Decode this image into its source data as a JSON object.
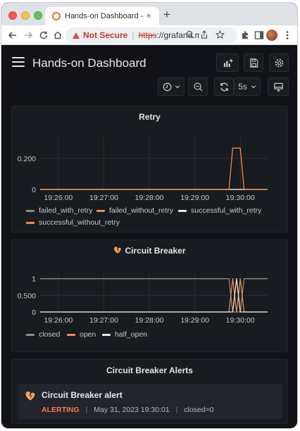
{
  "browser": {
    "tab_title": "Hands-on Dashboard - Grafana",
    "new_tab": "+",
    "tab_close": "×",
    "security_label": "Not Secure",
    "url_scheme": "https",
    "url_rest": "://grafana.mi..."
  },
  "dashboard": {
    "title": "Hands-on Dashboard",
    "refresh_interval": "5s"
  },
  "panels": {
    "retry": {
      "title": "Retry"
    },
    "circuit": {
      "title": "Circuit Breaker"
    },
    "alerts": {
      "title": "Circuit Breaker Alerts",
      "alert_name": "Circuit Breaker alert",
      "state": "ALERTING",
      "separator": "|",
      "timestamp": "May 31, 2023 19:30:01",
      "labels": "closed=0"
    }
  },
  "colors": {
    "background": "#111217",
    "panel": "#181b1f",
    "orange": "#f08a52",
    "gray": "#8e8e8e",
    "white": "#e6e6e6",
    "alerting": "#ff7a4a",
    "broken_heart": "#f5a25d"
  },
  "icons": {
    "menu": "hamburger-icon",
    "add_panel": "add-panel-icon",
    "save": "save-icon",
    "settings": "gear-icon",
    "time_picker": "clock-icon",
    "zoom_out": "zoom-out-icon",
    "refresh": "refresh-icon",
    "tv_mode": "monitor-icon",
    "circuit_breaker": "broken-heart-icon"
  },
  "chart_data": [
    {
      "type": "line",
      "title": "Retry",
      "x_ticks": [
        "19:26:00",
        "19:27:00",
        "19:28:00",
        "19:29:00",
        "19:30:00"
      ],
      "y_ticks": [
        "0",
        "0.200"
      ],
      "ylim": [
        0,
        0.3
      ],
      "xlim": [
        "19:25:36",
        "19:30:36"
      ],
      "grid": true,
      "legend_position": "bottom",
      "series": [
        {
          "name": "failed_with_retry",
          "color": "#8e8e8e",
          "x": [
            "19:25:36",
            "19:30:36"
          ],
          "y": [
            0,
            0
          ]
        },
        {
          "name": "failed_without_retry",
          "color": "#f08a52",
          "x": [
            "19:25:36",
            "19:30:36"
          ],
          "y": [
            0,
            0
          ]
        },
        {
          "name": "successful_with_retry",
          "color": "#e6e6e6",
          "x": [
            "19:25:36",
            "19:30:36"
          ],
          "y": [
            0,
            0
          ]
        },
        {
          "name": "successful_without_retry",
          "color": "#f08a52",
          "x": [
            "19:25:36",
            "19:29:45",
            "19:29:50",
            "19:30:00",
            "19:30:05",
            "19:30:36"
          ],
          "y": [
            0,
            0,
            0.267,
            0.267,
            0,
            0
          ]
        }
      ]
    },
    {
      "type": "line",
      "title": "Circuit Breaker",
      "x_ticks": [
        "19:26:00",
        "19:27:00",
        "19:28:00",
        "19:29:00",
        "19:30:00"
      ],
      "y_ticks": [
        "0",
        "0.500",
        "1"
      ],
      "ylim": [
        0,
        1.1
      ],
      "xlim": [
        "19:25:36",
        "19:30:36"
      ],
      "grid": true,
      "legend_position": "bottom",
      "series": [
        {
          "name": "closed",
          "color": "#8e8e8e",
          "x": [
            "19:25:36",
            "19:29:45",
            "19:29:50",
            "19:29:55",
            "19:30:00",
            "19:30:05",
            "19:30:36"
          ],
          "y": [
            1,
            1,
            0,
            0,
            0,
            1,
            1
          ]
        },
        {
          "name": "open",
          "color": "#f08a52",
          "x": [
            "19:25:36",
            "19:29:45",
            "19:29:50",
            "19:29:55",
            "19:30:00",
            "19:30:05",
            "19:30:36"
          ],
          "y": [
            0,
            0,
            1,
            0,
            1,
            0,
            0
          ]
        },
        {
          "name": "half_open",
          "color": "#e6e6e6",
          "x": [
            "19:25:36",
            "19:29:50",
            "19:29:55",
            "19:30:00",
            "19:30:36"
          ],
          "y": [
            0,
            0,
            1,
            0,
            0
          ]
        }
      ]
    }
  ]
}
